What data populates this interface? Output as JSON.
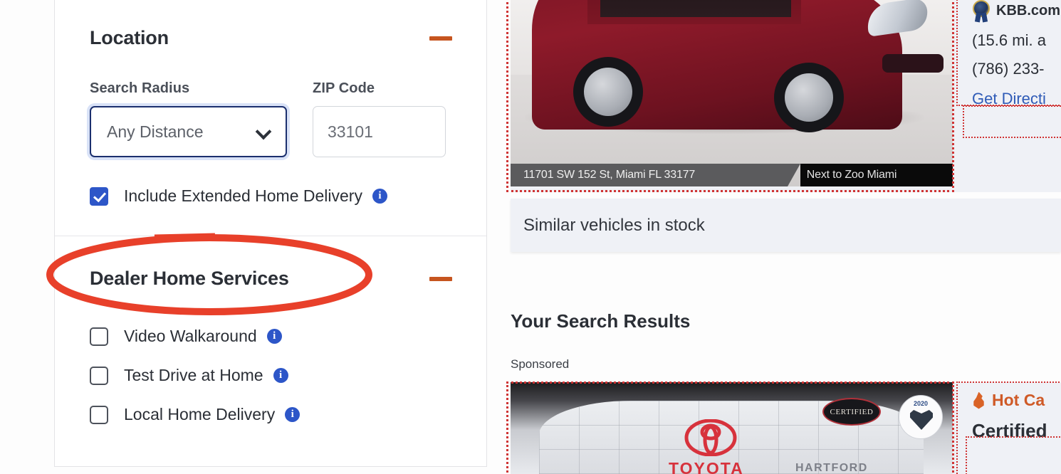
{
  "filters": {
    "location": {
      "title": "Location",
      "collapse_icon": "minus-icon",
      "search_radius_label": "Search Radius",
      "search_radius_value": "Any Distance",
      "zip_label": "ZIP Code",
      "zip_value": "33101",
      "extended_delivery_label": "Include Extended Home Delivery",
      "extended_delivery_checked": true,
      "info_icon": "info-icon"
    },
    "dealer_home_services": {
      "title": "Dealer Home Services",
      "collapse_icon": "minus-icon",
      "options": [
        {
          "label": "Video Walkaround",
          "checked": false
        },
        {
          "label": "Test Drive at Home",
          "checked": false
        },
        {
          "label": "Local Home Delivery",
          "checked": false
        }
      ]
    }
  },
  "annotation": {
    "shape": "ellipse",
    "color": "#e8402a",
    "target": "Dealer Home Services"
  },
  "results": {
    "featured_vehicle": {
      "photo_banner_address": "11701 SW 152 St, Miami FL 33177",
      "photo_banner_tagline": "Next to Zoo Miami",
      "kbb_icon": "kbb-award-icon",
      "kbb_label": "KBB.com",
      "distance": "(15.6 mi. a",
      "phone": "(786) 233-",
      "get_directions": "Get Directi",
      "similar_vehicles": "Similar vehicles in stock"
    },
    "section_title": "Your Search Results",
    "sponsored_label": "Sponsored",
    "sponsored_listing": {
      "dealer_logo_word": "TOYOTA",
      "dealer_name_word": "HARTFORD",
      "certified_badge": "CERTIFIED",
      "award_year": "2020",
      "hot_car_icon": "flame-icon",
      "hot_car_label": "Hot Ca",
      "title": "Certified"
    }
  },
  "colors": {
    "accent_orange": "#c6551f",
    "link_blue": "#2f5bb7",
    "checkbox_blue": "#2d56c8",
    "annotation_red": "#e8402a",
    "highlight_box_red": "#cf3434",
    "card_bg": "#eff1f6"
  }
}
